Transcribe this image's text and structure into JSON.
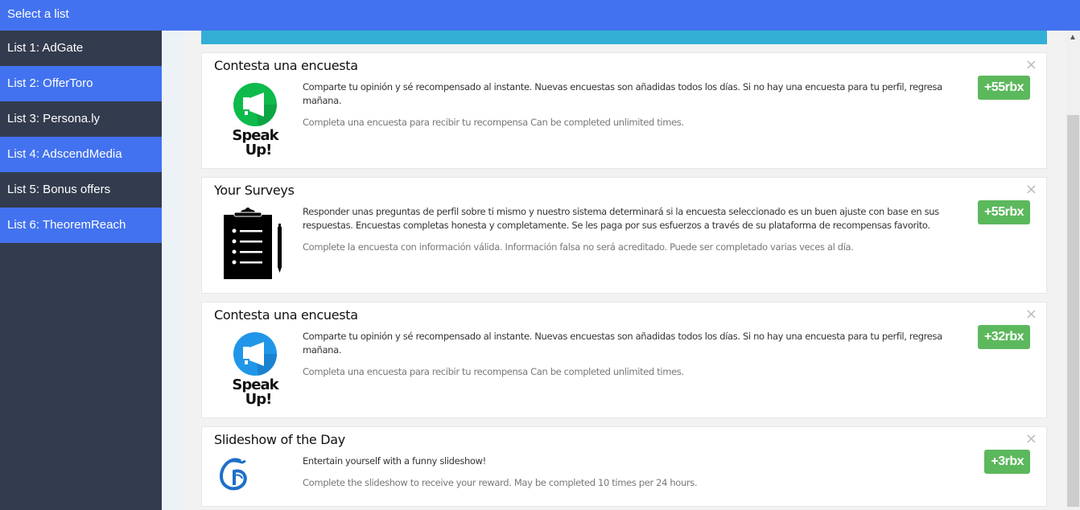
{
  "header": {
    "title": "Select a list"
  },
  "sidebar": {
    "items": [
      {
        "label": "List 1: AdGate",
        "style": "dark"
      },
      {
        "label": "List 2: OfferToro",
        "style": "blue"
      },
      {
        "label": "List 3: Persona.ly",
        "style": "dark"
      },
      {
        "label": "List 4: AdscendMedia",
        "style": "blue"
      },
      {
        "label": "List 5: Bonus offers",
        "style": "dark"
      },
      {
        "label": "List 6: TheoremReach",
        "style": "blue"
      }
    ]
  },
  "offers": [
    {
      "title": "Contesta una encuesta",
      "logo": "speak-up-green-logo",
      "description": "Comparte tu opinión y sé recompensado al instante. Nuevas encuestas son añadidas todos los días. Si no hay una encuesta para tu perfil, regresa mañana.",
      "requirement": "Completa una encuesta para recibir tu recompensa Can be completed unlimited times.",
      "reward": "+55rbx",
      "close": "×"
    },
    {
      "title": "Your Surveys",
      "logo": "clipboard-icon",
      "description": "Responder unas preguntas de perfil sobre ti mismo y nuestro sistema determinará si la encuesta seleccionado es un buen ajuste con base en sus respuestas. Encuestas completas honesta y completamente. Se les paga por sus esfuerzos a través de su plataforma de recompensas favorito.",
      "requirement": "Complete la encuesta con información válida. Información falsa no será acreditado. Puede ser completado varias veces al día.",
      "reward": "+55rbx",
      "close": "×"
    },
    {
      "title": "Contesta una encuesta",
      "logo": "speak-up-blue-logo",
      "description": "Comparte tu opinión y sé recompensado al instante. Nuevas encuestas son añadidas todos los días. Si no hay una encuesta para tu perfil, regresa mañana.",
      "requirement": "Completa una encuesta para recibir tu recompensa Can be completed unlimited times.",
      "reward": "+32rbx",
      "close": "×"
    },
    {
      "title": "Slideshow of the Day",
      "logo": "gothic-g-logo",
      "description": "Entertain yourself with a funny slideshow!",
      "requirement": "Complete the slideshow to receive your reward. May be completed 10 times per 24 hours.",
      "reward": "+3rbx",
      "close": "×"
    }
  ],
  "logo_text": {
    "speak": "Speak",
    "up": "Up!"
  },
  "colors": {
    "header": "#4272ef",
    "sidebar_dark": "#333b4e",
    "sidebar_blue": "#4272ef",
    "accent_bar": "#33afd5",
    "reward": "#5cb85c",
    "speakup_green": "#0dba4b",
    "speakup_blue": "#2196e8"
  },
  "scrollbar": {
    "up_arrow": "▲"
  }
}
